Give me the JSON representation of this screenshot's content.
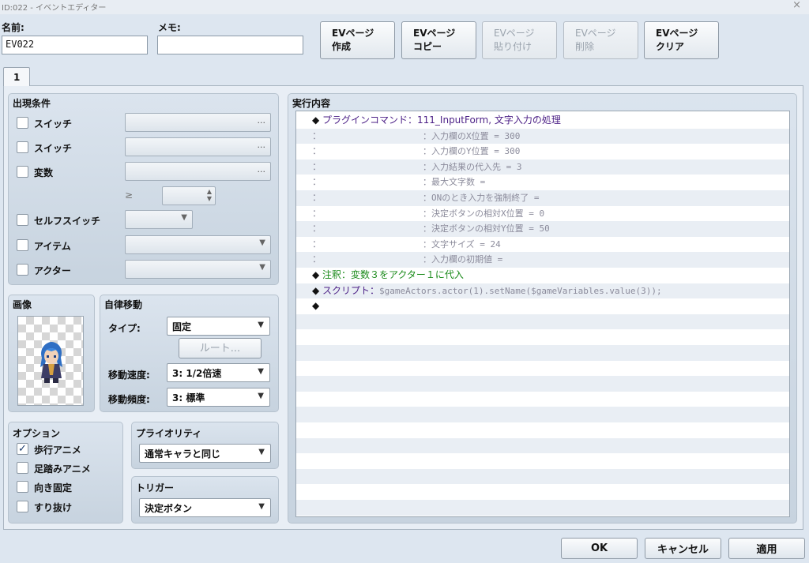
{
  "window": {
    "title": "ID:022 - イベントエディター",
    "close_glyph": "×"
  },
  "header": {
    "name_label": "名前:",
    "name_value": "EV022",
    "memo_label": "メモ:",
    "memo_value": ""
  },
  "ev_buttons": [
    {
      "line1": "EVページ",
      "line2": "作成",
      "enabled": true
    },
    {
      "line1": "EVページ",
      "line2": "コピー",
      "enabled": true
    },
    {
      "line1": "EVページ",
      "line2": "貼り付け",
      "enabled": false
    },
    {
      "line1": "EVページ",
      "line2": "削除",
      "enabled": false
    },
    {
      "line1": "EVページ",
      "line2": "クリア",
      "enabled": true
    }
  ],
  "tabs": [
    {
      "label": "1"
    }
  ],
  "conditions": {
    "title": "出現条件",
    "switch1_label": "スイッチ",
    "switch2_label": "スイッチ",
    "variable_label": "変数",
    "ge_symbol": "≥",
    "self_switch_label": "セルフスイッチ",
    "item_label": "アイテム",
    "actor_label": "アクター",
    "ellipsis": "..."
  },
  "image": {
    "title": "画像"
  },
  "autonomous": {
    "title": "自律移動",
    "type_label": "タイプ:",
    "type_value": "固定",
    "route_button": "ルート...",
    "speed_label": "移動速度:",
    "speed_value": "3: 1/2倍速",
    "freq_label": "移動頻度:",
    "freq_value": "3: 標準"
  },
  "options": {
    "title": "オプション",
    "items": [
      {
        "label": "歩行アニメ",
        "checked": true
      },
      {
        "label": "足踏みアニメ",
        "checked": false
      },
      {
        "label": "向き固定",
        "checked": false
      },
      {
        "label": "すり抜け",
        "checked": false
      }
    ]
  },
  "priority": {
    "title": "プライオリティ",
    "value": "通常キャラと同じ"
  },
  "trigger": {
    "title": "トリガー",
    "value": "決定ボタン"
  },
  "contents": {
    "title": "実行内容",
    "lines": [
      {
        "marker": "◆",
        "prefix": "プラグインコマンド：",
        "text": "111_InputForm, 文字入力の処理",
        "color": "purple"
      },
      {
        "marker": "：",
        "prefix": "",
        "text": "：入力欄のX位置 = 300",
        "color": "gray"
      },
      {
        "marker": "：",
        "prefix": "",
        "text": "：入力欄のY位置 = 300",
        "color": "gray"
      },
      {
        "marker": "：",
        "prefix": "",
        "text": "：入力結果の代入先 = 3",
        "color": "gray"
      },
      {
        "marker": "：",
        "prefix": "",
        "text": "：最大文字数 =",
        "color": "gray"
      },
      {
        "marker": "：",
        "prefix": "",
        "text": "：ONのとき入力を強制終了 =",
        "color": "gray"
      },
      {
        "marker": "：",
        "prefix": "",
        "text": "：決定ボタンの相対X位置 = 0",
        "color": "gray"
      },
      {
        "marker": "：",
        "prefix": "",
        "text": "：決定ボタンの相対Y位置 = 50",
        "color": "gray"
      },
      {
        "marker": "：",
        "prefix": "",
        "text": "：文字サイズ = 24",
        "color": "gray"
      },
      {
        "marker": "：",
        "prefix": "",
        "text": "：入力欄の初期値 =",
        "color": "gray"
      },
      {
        "marker": "◆",
        "prefix": "注釈：",
        "text": "変数３をアクター１に代入",
        "color": "green"
      },
      {
        "marker": "◆",
        "prefix": "スクリプト：",
        "text": "$gameActors.actor(1).setName($gameVariables.value(3));",
        "color": "script"
      },
      {
        "marker": "◆",
        "prefix": "",
        "text": "",
        "color": "black"
      }
    ]
  },
  "footer": {
    "ok": "OK",
    "cancel": "キャンセル",
    "apply": "適用"
  },
  "colors": {
    "purple": "#4b1f86",
    "green": "#1a8a1a",
    "gray": "#8b8b9b",
    "accent_dark": "#1d3d6e"
  }
}
